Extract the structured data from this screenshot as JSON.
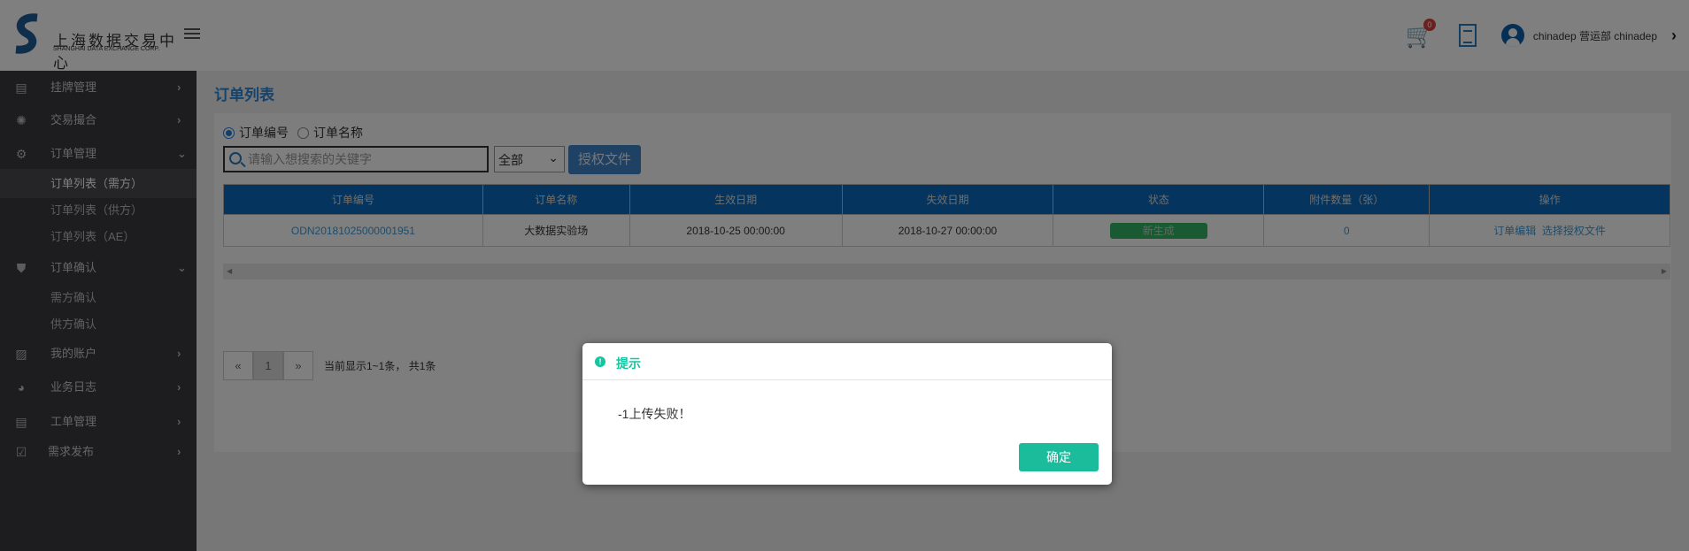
{
  "header": {
    "logo_cn": "上海数据交易中心",
    "logo_en": "SHANGHAI DATA EXCHANGE CORP.",
    "cart_count": "0",
    "user": "chinadep 营运部 chinadep"
  },
  "sidebar": {
    "items": [
      {
        "label": "挂牌管理",
        "icon": "id-card-icon",
        "arrow": "›"
      },
      {
        "label": "交易撮合",
        "icon": "atom-icon",
        "arrow": "›"
      },
      {
        "label": "订单管理",
        "icon": "gear-icon",
        "arrow": "⌄"
      },
      {
        "label": "订单确认",
        "icon": "shield-icon",
        "arrow": "⌄"
      },
      {
        "label": "我的账户",
        "icon": "report-search-icon",
        "arrow": "›"
      },
      {
        "label": "业务日志",
        "icon": "pie-chart-icon",
        "arrow": "›"
      },
      {
        "label": "工单管理",
        "icon": "document-icon",
        "arrow": "›"
      },
      {
        "label": "需求发布",
        "icon": "checkbox-icon",
        "arrow": "›"
      }
    ],
    "order_subs": [
      "订单列表（需方）",
      "订单列表（供方）",
      "订单列表（AE）"
    ],
    "confirm_subs": [
      "需方确认",
      "供方确认"
    ]
  },
  "main": {
    "title": "订单列表",
    "radio_options": [
      "订单编号",
      "订单名称"
    ],
    "radio_selected": "订单编号",
    "search_placeholder": "请输入想搜索的关键字",
    "select_value": "全部",
    "auth_button": "授权文件",
    "columns": [
      "订单编号",
      "订单名称",
      "生效日期",
      "失效日期",
      "状态",
      "附件数量（张）",
      "操作"
    ],
    "rows": [
      {
        "id": "ODN20181025000001951",
        "name": "大数据实验场",
        "start": "2018-10-25 00:00:00",
        "end": "2018-10-27 00:00:00",
        "status": "新生成",
        "attachments": "0",
        "action_edit": "订单编辑",
        "action_select": "选择授权文件"
      }
    ],
    "pager": {
      "prev": "«",
      "current": "1",
      "next": "»",
      "info": "当前显示1~1条，  共1条"
    }
  },
  "modal": {
    "title": "提示",
    "message": "-1上传失败！",
    "ok": "确定",
    "accent": "#1abc9c"
  }
}
